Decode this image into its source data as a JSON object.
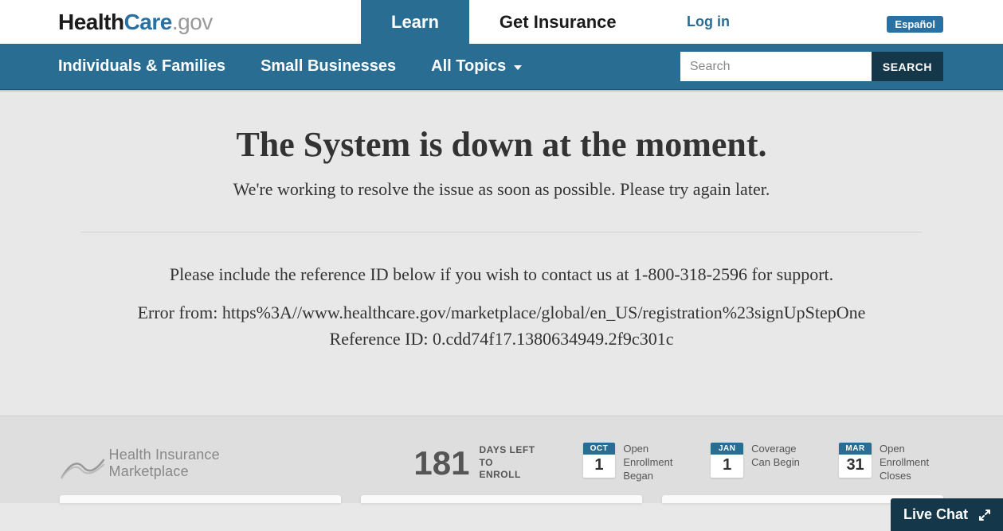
{
  "logo": {
    "health": "Health",
    "care": "Care",
    "gov": ".gov"
  },
  "top_tabs": {
    "learn": "Learn",
    "get_insurance": "Get Insurance"
  },
  "login": "Log in",
  "language_button": "Español",
  "nav": {
    "individuals": "Individuals & Families",
    "small_biz": "Small Businesses",
    "all_topics": "All Topics"
  },
  "search": {
    "placeholder": "Search",
    "button": "SEARCH"
  },
  "error_page": {
    "heading": "The System is down at the moment.",
    "subheading": "We're working to resolve the issue as soon as possible. Please try again later.",
    "support_line": "Please include the reference ID below if you wish to contact us at 1-800-318-2596 for support.",
    "error_from": "Error from: https%3A//www.healthcare.gov/marketplace/global/en_US/registration%23signUpStepOne",
    "reference_id": "Reference ID: 0.cdd74f17.1380634949.2f9c301c"
  },
  "footer": {
    "marketplace_label": "Health Insurance Marketplace",
    "countdown_number": "181",
    "countdown_label_line1": "DAYS LEFT TO",
    "countdown_label_line2": "ENROLL",
    "milestones": [
      {
        "month": "OCT",
        "day": "1",
        "text": "Open Enrollment Began"
      },
      {
        "month": "JAN",
        "day": "1",
        "text": "Coverage Can Begin"
      },
      {
        "month": "MAR",
        "day": "31",
        "text": "Open Enrollment Closes"
      }
    ]
  },
  "live_chat": "Live Chat"
}
